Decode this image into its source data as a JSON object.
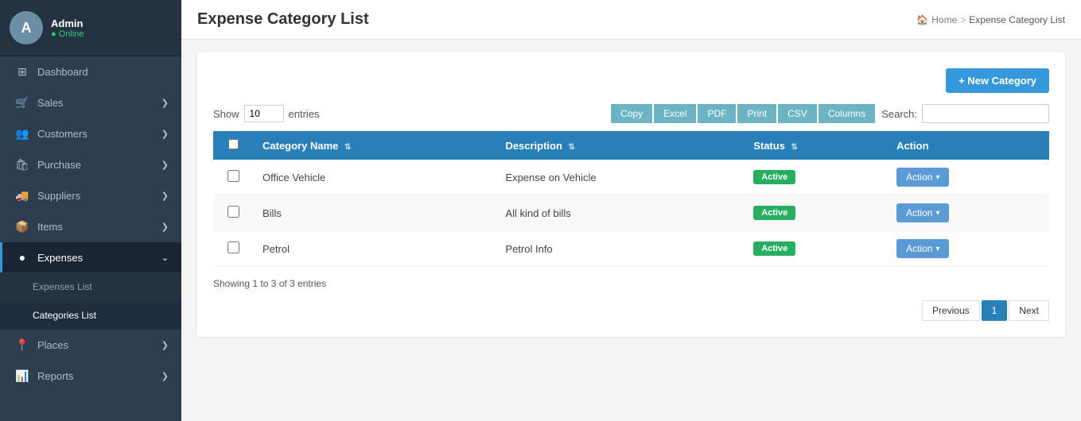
{
  "sidebar": {
    "profile": {
      "name": "Admin",
      "status": "Online",
      "avatar_initial": "A"
    },
    "items": [
      {
        "id": "dashboard",
        "icon": "⊞",
        "label": "Dashboard",
        "hasChevron": false
      },
      {
        "id": "sales",
        "icon": "🛒",
        "label": "Sales",
        "hasChevron": true
      },
      {
        "id": "customers",
        "icon": "👥",
        "label": "Customers",
        "hasChevron": true
      },
      {
        "id": "purchase",
        "icon": "🛍",
        "label": "Purchase",
        "hasChevron": true
      },
      {
        "id": "suppliers",
        "icon": "🚚",
        "label": "Suppliers",
        "hasChevron": true
      },
      {
        "id": "items",
        "icon": "📦",
        "label": "Items",
        "hasChevron": true
      },
      {
        "id": "expenses",
        "icon": "●",
        "label": "Expenses",
        "hasChevron": true,
        "active": true
      }
    ],
    "sub_items": [
      {
        "id": "expenses-list",
        "label": "Expenses List"
      },
      {
        "id": "categories-list",
        "label": "Categories List",
        "active": true
      }
    ],
    "bottom_items": [
      {
        "id": "places",
        "icon": "📍",
        "label": "Places",
        "hasChevron": true
      },
      {
        "id": "reports",
        "icon": "📊",
        "label": "Reports",
        "hasChevron": true
      }
    ]
  },
  "topbar": {
    "title": "Expense Category List",
    "breadcrumb": {
      "home": "Home",
      "sep": ">",
      "current": "Expense Category List"
    }
  },
  "toolbar": {
    "new_category_label": "+ New Category"
  },
  "table_controls": {
    "show_label": "Show",
    "show_value": "10",
    "entries_label": "entries",
    "search_label": "Search:",
    "search_placeholder": "",
    "buttons": [
      {
        "id": "copy",
        "label": "Copy"
      },
      {
        "id": "excel",
        "label": "Excel"
      },
      {
        "id": "pdf",
        "label": "PDF"
      },
      {
        "id": "print",
        "label": "Print"
      },
      {
        "id": "csv",
        "label": "CSV"
      },
      {
        "id": "columns",
        "label": "Columns"
      }
    ]
  },
  "table": {
    "headers": [
      {
        "id": "checkbox",
        "label": ""
      },
      {
        "id": "category-name",
        "label": "Category Name",
        "sortable": true
      },
      {
        "id": "description",
        "label": "Description",
        "sortable": true
      },
      {
        "id": "status",
        "label": "Status",
        "sortable": true
      },
      {
        "id": "action",
        "label": "Action"
      }
    ],
    "rows": [
      {
        "id": 1,
        "category_name": "Office Vehicle",
        "description": "Expense on Vehicle",
        "status": "Active",
        "action_label": "Action ▾"
      },
      {
        "id": 2,
        "category_name": "Bills",
        "description": "All kind of bills",
        "status": "Active",
        "action_label": "Action ▾"
      },
      {
        "id": 3,
        "category_name": "Petrol",
        "description": "Petrol Info",
        "status": "Active",
        "action_label": "Action ▾"
      }
    ]
  },
  "footer": {
    "showing_text": "Showing 1 to 3 of 3 entries"
  },
  "pagination": {
    "prev_label": "Previous",
    "page_label": "1",
    "next_label": "Next"
  }
}
